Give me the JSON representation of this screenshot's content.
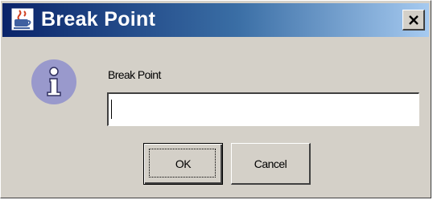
{
  "window": {
    "title": "Break Point",
    "app_icon": "java-cup-icon",
    "close_icon": "close-icon"
  },
  "content": {
    "message_icon": "info-icon",
    "field_label": "Break Point",
    "field_value": ""
  },
  "buttons": {
    "ok_label": "OK",
    "cancel_label": "Cancel"
  },
  "colors": {
    "title_gradient_start": "#0a246a",
    "title_gradient_end": "#a6caf0",
    "dialog_background": "#d4d0c8",
    "info_icon_fill": "#9999cc"
  }
}
